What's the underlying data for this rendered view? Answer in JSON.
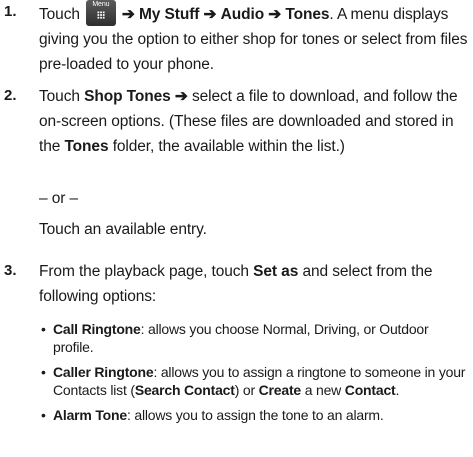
{
  "steps": [
    {
      "number": "1.",
      "touch": "Touch",
      "menu_key_label": "Menu",
      "arrow": "➔",
      "path1": "My Stuff",
      "path2": "Audio",
      "path3": "Tones",
      "rest": ". A menu displays giving you the option to either shop for tones or select from files pre-loaded to your phone."
    },
    {
      "number": "2.",
      "touch": "Touch",
      "shop_tones": "Shop Tones",
      "arrow": "➔",
      "text_a": "select a file to download, and follow the on-screen options. (These files are downloaded and stored in the",
      "tones_folder": "Tones",
      "text_b": "folder, the available within the list.)",
      "or": "– or –",
      "alt": "Touch an available entry."
    },
    {
      "number": "3.",
      "text_a": "From the playback page, touch",
      "set_as": "Set as",
      "text_b": "and select from the following options:",
      "options": [
        {
          "name": "Call Ringtone",
          "desc": ": allows you choose Normal, Driving, or Outdoor profile."
        },
        {
          "name": "Caller Ringtone",
          "desc_a": ": allows you to assign a ringtone to someone in your Contacts list (",
          "search": "Search Contact",
          "desc_b": ") or",
          "create": "Create",
          "desc_c": "a new",
          "contact": "Contact",
          "desc_d": "."
        },
        {
          "name": "Alarm Tone",
          "desc": ": allows you to assign the tone to an alarm."
        }
      ]
    }
  ]
}
